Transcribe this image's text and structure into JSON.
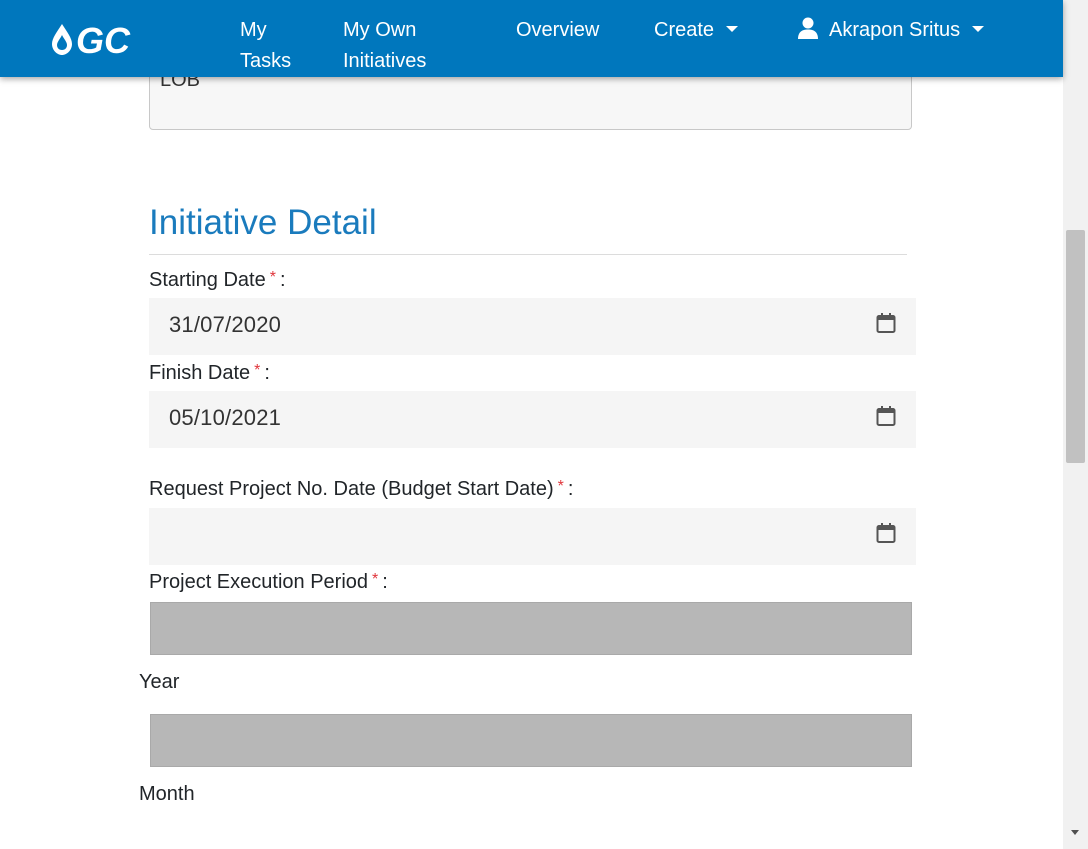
{
  "navbar": {
    "brand_logo": "GC",
    "links": {
      "my_tasks": [
        "My",
        "Tasks"
      ],
      "my_own_initiatives": [
        "My Own",
        "Initiatives"
      ],
      "overview": "Overview",
      "create": "Create"
    },
    "user": {
      "name": "Akrapon Sritus",
      "icon": "user-icon"
    },
    "color": "#0077bd"
  },
  "form": {
    "lob_value": "LOB",
    "section_title": "Initiative Detail",
    "required_marker": "*",
    "starting_date": {
      "label": "Starting Date",
      "value": "31/07/2020"
    },
    "finish_date": {
      "label": "Finish Date",
      "value": "05/10/2021"
    },
    "request_project_no_date": {
      "label": "Request Project No. Date (Budget Start Date)",
      "value": ""
    },
    "project_execution_period": {
      "label": "Project Execution Period",
      "year_label": "Year",
      "month_label": "Month"
    },
    "label_suffix": ":"
  }
}
